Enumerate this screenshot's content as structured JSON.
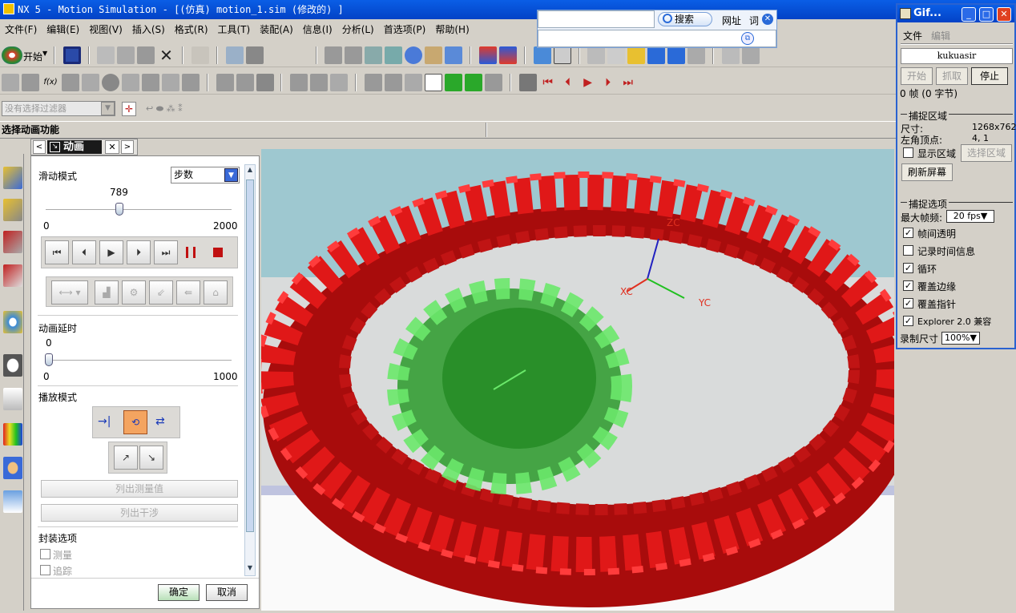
{
  "window": {
    "title": "NX 5 - Motion Simulation - [(仿真) motion_1.sim  (修改的) ]"
  },
  "menu": [
    "文件(F)",
    "编辑(E)",
    "视图(V)",
    "插入(S)",
    "格式(R)",
    "工具(T)",
    "装配(A)",
    "信息(I)",
    "分析(L)",
    "首选项(P)",
    "帮助(H)"
  ],
  "start_button": "开始",
  "filter": {
    "placeholder": "没有选择过滤器"
  },
  "cue_line": "选择动画功能",
  "search_bar": {
    "search_label": "搜索",
    "url_label": "网址",
    "word_label": "词"
  },
  "animation_panel": {
    "title": "动画",
    "slide_mode_label": "滑动模式",
    "slide_mode_value": "步数",
    "step_value": "789",
    "step_min": "0",
    "step_max": "2000",
    "step_fraction": 0.3945,
    "delay_label": "动画延时",
    "delay_value": "0",
    "delay_min": "0",
    "delay_max": "1000",
    "play_mode_label": "播放模式",
    "list_measure": "列出测量值",
    "list_interference": "列出干涉",
    "package_label": "封装选项",
    "measure_label": "测量",
    "trace_label": "追踪",
    "ok_label": "确定",
    "cancel_label": "取消"
  },
  "viewport": {
    "axis_zc": "ZC",
    "axis_xc": "XC",
    "axis_yc": "YC",
    "ring_color": "#e01818",
    "ring_side_color": "#a80c0c",
    "gear_color": "#3ec83e"
  },
  "gif_recorder": {
    "title": "Gif...",
    "menu_file": "文件",
    "menu_edit": "编辑",
    "user": "kukuasir",
    "btn_start": "开始",
    "btn_capture": "抓取",
    "btn_stop": "停止",
    "frames": "0 帧 (0 字节)",
    "capture_area_label": "捕捉区域",
    "size_label": "尺寸:",
    "size_value": "1268x762",
    "corner_label": "左角顶点:",
    "corner_value": "4, 1",
    "show_area_label": "显示区域",
    "select_area_btn": "选择区域",
    "refresh_btn": "刷新屏幕",
    "capture_options_label": "捕捉选项",
    "max_fps_label": "最大帧频:",
    "max_fps_value": "20 fps",
    "opt_transparent": "帧间透明",
    "opt_record_time": "记录时间信息",
    "opt_loop": "循环",
    "opt_cover_edge": "覆盖边缘",
    "opt_cover_pointer": "覆盖指针",
    "opt_explorer": "Explorer 2.0 兼容",
    "rec_size_label": "录制尺寸",
    "rec_size_value": "100%"
  }
}
